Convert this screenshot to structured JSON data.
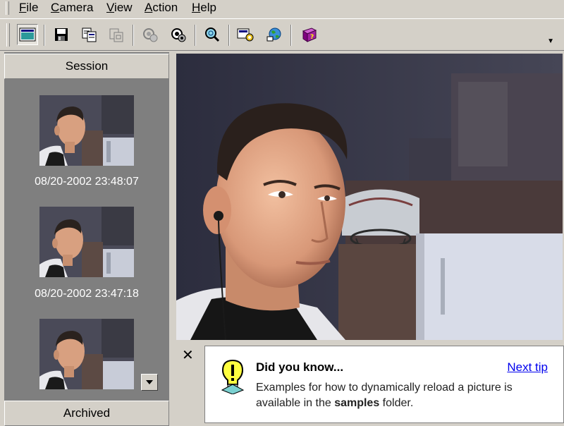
{
  "menu": {
    "items": [
      "File",
      "Camera",
      "View",
      "Action",
      "Help"
    ]
  },
  "toolbar": {
    "buttons": [
      "preview-icon",
      "save-icon",
      "copy-icon",
      "paste-icon",
      "camera-disabled-icon",
      "camera-icon",
      "search-icon",
      "settings-icon",
      "web-publish-icon",
      "help-book-icon"
    ],
    "pressed": "preview-icon"
  },
  "left_pane": {
    "session_label": "Session",
    "archived_label": "Archived",
    "thumbnails": [
      {
        "timestamp": "08/20-2002 23:48:07"
      },
      {
        "timestamp": "08/20-2002 23:47:18"
      },
      {
        "timestamp": ""
      }
    ]
  },
  "tip": {
    "close_symbol": "✕",
    "title": "Did you know...",
    "next_link": "Next tip",
    "text_before": "Examples for how to dynamically reload a picture is available in the ",
    "text_bold": "samples",
    "text_after": " folder."
  },
  "colors": {
    "chrome": "#d4d0c8",
    "thumb_panel": "#7f7f7f",
    "link": "#0000ee"
  }
}
